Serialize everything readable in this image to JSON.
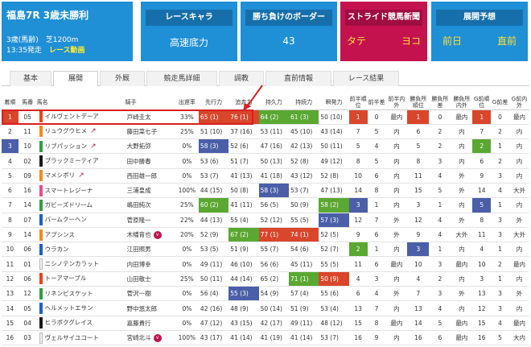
{
  "race": {
    "title": "福島7R 3歳未勝利",
    "condition": "3歳(馬齢)　芝1200m",
    "start": "13:35発走",
    "video": "レース動画"
  },
  "cards": {
    "chara": {
      "head": "レースキャラ",
      "value": "高速底力"
    },
    "border": {
      "head": "勝ち負けのボーダー",
      "value": "43"
    },
    "news": {
      "head": "ストライド競馬新聞",
      "v1": "タテ",
      "v2": "ヨコ"
    },
    "yosou": {
      "head": "展開予想",
      "v1": "前日",
      "v2": "直前"
    }
  },
  "tabs": [
    "基本",
    "展開",
    "外厩",
    "競走馬詳細",
    "調教",
    "直前情報",
    "レース結果"
  ],
  "active_tab": "展開",
  "headers": [
    "着順",
    "馬番",
    "馬名",
    "騎手",
    "出遅率",
    "先行力",
    "追走力",
    "持久力",
    "持続力",
    "瞬発力",
    "前半順位",
    "前半差",
    "前半内外",
    "勝負所順位",
    "勝負所差",
    "勝負所内外",
    "G前順位",
    "G前差",
    "G前内外"
  ],
  "rows": [
    {
      "rank": "1",
      "num": "05",
      "name": "イルヴェントデーア",
      "color": "#e8451f",
      "tag": "",
      "v": false,
      "jockey": "戸崎圭太",
      "delay": "33%",
      "c5": "65 (1)",
      "c6": "76 (1)",
      "c7": "64 (2)",
      "c8": "61 (3)",
      "c9": "50 (10)",
      "c10": "1",
      "c11": "0",
      "c12": "最内",
      "c13": "1",
      "c14": "0",
      "c15": "最内",
      "c16": "1",
      "c17": "0",
      "c18": "最内"
    },
    {
      "rank": "2",
      "num": "11",
      "name": "リュウグウヒメ",
      "color": "#f08a1c",
      "tag": "↗",
      "v": false,
      "jockey": "藤田菜七子",
      "delay": "25%",
      "c5": "51 (10)",
      "c6": "37 (16)",
      "c7": "53 (11)",
      "c8": "45 (10)",
      "c9": "43 (14)",
      "c10": "7",
      "c11": "5",
      "c12": "内",
      "c13": "6",
      "c14": "2",
      "c15": "内",
      "c16": "7",
      "c17": "2",
      "c18": "内"
    },
    {
      "rank": "3",
      "num": "10",
      "name": "リブパッション",
      "color": "#2e9e44",
      "tag": "↗",
      "v": false,
      "jockey": "大野拓弥",
      "delay": "0%",
      "c5": "58 (3)",
      "c6": "52 (6)",
      "c7": "47 (16)",
      "c8": "42 (13)",
      "c9": "50 (11)",
      "c10": "5",
      "c11": "4",
      "c12": "内",
      "c13": "5",
      "c14": "2",
      "c15": "内",
      "c16": "2",
      "c17": "1",
      "c18": "内"
    },
    {
      "rank": "4",
      "num": "02",
      "name": "ブラックミーティア",
      "color": "#1a1a1a",
      "tag": "",
      "v": false,
      "jockey": "田中勝春",
      "delay": "0%",
      "c5": "53 (6)",
      "c6": "51 (7)",
      "c7": "50 (13)",
      "c8": "52 (8)",
      "c9": "49 (12)",
      "c10": "8",
      "c11": "5",
      "c12": "内",
      "c13": "8",
      "c14": "3",
      "c15": "内",
      "c16": "6",
      "c17": "2",
      "c18": "内"
    },
    {
      "rank": "5",
      "num": "09",
      "name": "マメシボリ",
      "color": "#f08a1c",
      "tag": "↗",
      "v": false,
      "jockey": "西田雄一郎",
      "delay": "0%",
      "c5": "53 (7)",
      "c6": "41 (13)",
      "c7": "41 (18)",
      "c8": "43 (12)",
      "c9": "52 (8)",
      "c10": "10",
      "c11": "6",
      "c12": "内",
      "c13": "11",
      "c14": "4",
      "c15": "外",
      "c16": "9",
      "c17": "3",
      "c18": "内"
    },
    {
      "rank": "6",
      "num": "16",
      "name": "スマートレジーナ",
      "color": "#e84d8a",
      "tag": "",
      "v": false,
      "jockey": "三浦皇成",
      "delay": "100%",
      "c5": "44 (15)",
      "c6": "50 (8)",
      "c7": "58 (3)",
      "c8": "53 (7)",
      "c9": "47 (13)",
      "c10": "14",
      "c11": "8",
      "c12": "内",
      "c13": "15",
      "c14": "5",
      "c15": "外",
      "c16": "14",
      "c17": "4",
      "c18": "大外"
    },
    {
      "rank": "7",
      "num": "14",
      "name": "ガビーズドリーム",
      "color": "#2e9e44",
      "tag": "",
      "v": false,
      "jockey": "嶋田純次",
      "delay": "25%",
      "c5": "60 (2)",
      "c6": "41 (11)",
      "c7": "56 (5)",
      "c8": "50 (9)",
      "c9": "58 (2)",
      "c10": "3",
      "c11": "1",
      "c12": "内",
      "c13": "3",
      "c14": "1",
      "c15": "内",
      "c16": "5",
      "c17": "1",
      "c18": "内"
    },
    {
      "rank": "8",
      "num": "07",
      "name": "バームクーヘン",
      "color": "#1f5fc4",
      "tag": "",
      "v": false,
      "jockey": "菅原隆一",
      "delay": "22%",
      "c5": "44 (13)",
      "c6": "55 (4)",
      "c7": "52 (12)",
      "c8": "55 (5)",
      "c9": "57 (3)",
      "c10": "12",
      "c11": "7",
      "c12": "外",
      "c13": "12",
      "c14": "4",
      "c15": "外",
      "c16": "8",
      "c17": "3",
      "c18": "外"
    },
    {
      "rank": "9",
      "num": "14",
      "name": "アプシンス",
      "color": "#f08a1c",
      "tag": "",
      "v": true,
      "jockey": "木幡育也",
      "delay": "20%",
      "c5": "52 (9)",
      "c6": "67 (2)",
      "c7": "77 (1)",
      "c8": "74 (1)",
      "c9": "52 (5)",
      "c10": "9",
      "c11": "6",
      "c12": "外",
      "c13": "9",
      "c14": "4",
      "c15": "大外",
      "c16": "11",
      "c17": "3",
      "c18": "大外"
    },
    {
      "rank": "10",
      "num": "06",
      "name": "ウラカン",
      "color": "#1f5fc4",
      "tag": "",
      "v": false,
      "jockey": "江田照男",
      "delay": "0%",
      "c5": "53 (5)",
      "c6": "51 (9)",
      "c7": "55 (7)",
      "c8": "54 (6)",
      "c9": "52 (7)",
      "c10": "2",
      "c11": "1",
      "c12": "内",
      "c13": "3",
      "c14": "1",
      "c15": "内",
      "c16": "4",
      "c17": "1",
      "c18": "内"
    },
    {
      "rank": "11",
      "num": "01",
      "name": "ニシノテンカラット",
      "color": "#f2f2f2",
      "tag": "",
      "v": false,
      "jockey": "内田博幸",
      "delay": "0%",
      "c5": "49 (11)",
      "c6": "46 (10)",
      "c7": "56 (6)",
      "c8": "45 (11)",
      "c9": "55 (5)",
      "c10": "11",
      "c11": "6",
      "c12": "最内",
      "c13": "10",
      "c14": "3",
      "c15": "最内",
      "c16": "10",
      "c17": "2",
      "c18": "最内"
    },
    {
      "rank": "12",
      "num": "06",
      "name": "トーアマーブル",
      "color": "#e8451f",
      "tag": "",
      "v": false,
      "jockey": "山田敬士",
      "delay": "25%",
      "c5": "50 (11)",
      "c6": "44 (14)",
      "c7": "65 (2)",
      "c8": "71 (1)",
      "c9": "50 (9)",
      "c10": "4",
      "c11": "3",
      "c12": "内",
      "c13": "4",
      "c14": "2",
      "c15": "内",
      "c16": "3",
      "c17": "1",
      "c18": "内"
    },
    {
      "rank": "13",
      "num": "12",
      "name": "リネンビスケット",
      "color": "#2e9e44",
      "tag": "",
      "v": false,
      "jockey": "菅沢一樹",
      "delay": "0%",
      "c5": "56 (4)",
      "c6": "55 (3)",
      "c7": "54 (9)",
      "c8": "57 (4)",
      "c9": "55 (6)",
      "c10": "6",
      "c11": "4",
      "c12": "外",
      "c13": "7",
      "c14": "3",
      "c15": "外",
      "c16": "13",
      "c17": "3",
      "c18": "外"
    },
    {
      "rank": "14",
      "num": "05",
      "name": "ヘルメットエサン",
      "color": "#1f5fc4",
      "tag": "",
      "v": false,
      "jockey": "野中悠太郎",
      "delay": "0%",
      "c5": "42 (16)",
      "c6": "48 (9)",
      "c7": "50 (14)",
      "c8": "51 (9)",
      "c9": "53 (4)",
      "c10": "13",
      "c11": "7",
      "c12": "内",
      "c13": "13",
      "c14": "4",
      "c15": "内",
      "c16": "12",
      "c17": "3",
      "c18": "内"
    },
    {
      "rank": "15",
      "num": "04",
      "name": "ヒラボクグレイス",
      "color": "#1a1a1a",
      "tag": "",
      "v": false,
      "jockey": "嘉藤貴行",
      "delay": "0%",
      "c5": "47 (12)",
      "c6": "43 (15)",
      "c7": "42 (17)",
      "c8": "49 (11)",
      "c9": "48 (12)",
      "c10": "15",
      "c11": "8",
      "c12": "最内",
      "c13": "14",
      "c14": "5",
      "c15": "最内",
      "c16": "15",
      "c17": "4",
      "c18": "最内"
    },
    {
      "rank": "16",
      "num": "03",
      "name": "ヴェルサイユコート",
      "color": "#f2f2f2",
      "tag": "",
      "v": true,
      "jockey": "宮崎北斗",
      "delay": "100%",
      "c5": "43 (17)",
      "c6": "41 (14)",
      "c7": "41 (19)",
      "c8": "41 (14)",
      "c9": "53 (7)",
      "c10": "16",
      "c11": "9",
      "c12": "内",
      "c13": "16",
      "c14": "6",
      "c15": "最内",
      "c16": "16",
      "c17": "5",
      "c18": "大内"
    }
  ],
  "highlights": {
    "r0": {
      "c5": "r1",
      "c6": "r1",
      "c7": "r2",
      "c8": "r2",
      "c10": "r1",
      "c13": "r1",
      "c16": "r1"
    },
    "r2": {
      "c5": "r3",
      "c16": "r2"
    },
    "r5": {
      "c7": "r3"
    },
    "r6": {
      "c5": "r2",
      "c9": "r2",
      "c10": "r3",
      "c16": "r3"
    },
    "r7": {
      "c9": "r3"
    },
    "r8": {
      "c6": "r2",
      "c7": "r1",
      "c8": "r1"
    },
    "r9": {
      "c10": "r2",
      "c13": "r3"
    },
    "r11": {
      "c8": "r2",
      "c9": "r1"
    },
    "r12": {
      "c6": "r3"
    }
  }
}
